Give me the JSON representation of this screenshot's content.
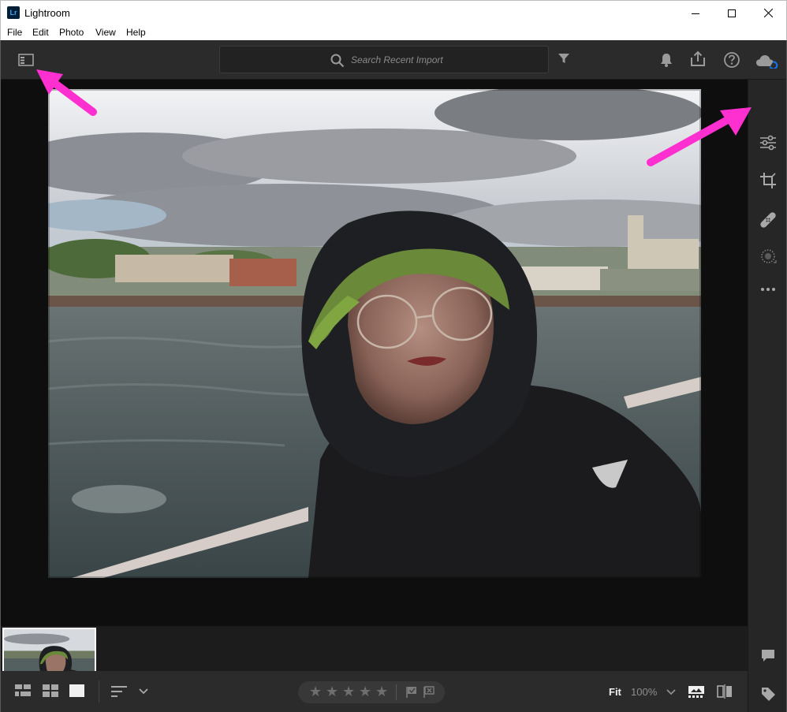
{
  "window": {
    "logo_text": "Lr",
    "title": "Lightroom"
  },
  "menu": [
    "File",
    "Edit",
    "Photo",
    "View",
    "Help"
  ],
  "search": {
    "placeholder": "Search Recent Import"
  },
  "bottom": {
    "zoom_fit": "Fit",
    "zoom_percent": "100%"
  },
  "icons": {
    "topbar": [
      "panel-toggle-icon",
      "search-icon",
      "filter-icon",
      "bell-icon",
      "share-icon",
      "help-icon",
      "cloud-sync-icon"
    ],
    "right_toolbar": [
      "edit-sliders-icon",
      "crop-icon",
      "healing-icon",
      "masking-icon",
      "more-icon",
      "comment-icon",
      "tag-icon",
      "info-icon"
    ]
  },
  "colors": {
    "accent_annotation": "#ff2fd0",
    "cloud_sync": "#1473e6",
    "app_bg": "#1f1f1f",
    "toolbar_bg": "#2b2b2b"
  }
}
